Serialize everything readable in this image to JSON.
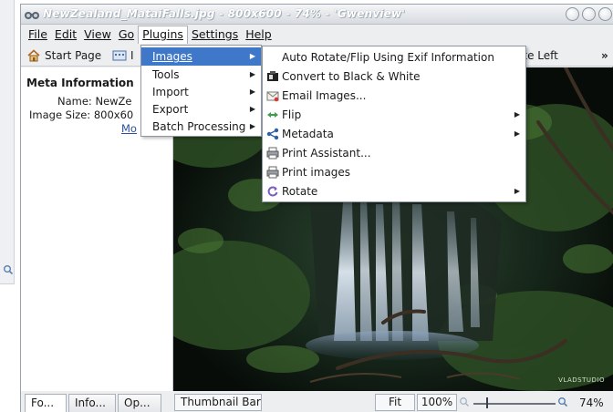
{
  "window": {
    "title": "NewZealand_MataiFalls.jpg - 800x600 - 74% - 'Gwenview'"
  },
  "menubar": {
    "items": [
      "File",
      "Edit",
      "View",
      "Go",
      "Plugins",
      "Settings",
      "Help"
    ]
  },
  "toolbar": {
    "start_page": "Start Page",
    "partial_label": "I",
    "rotate_left": "otate Left",
    "overflow": "»"
  },
  "sidebar": {
    "title": "Meta Information",
    "name_label": "Name:",
    "name_value": "NewZe",
    "size_label": "Image Size:",
    "size_value": "800x60",
    "more_link": "Mo"
  },
  "plugins_menu": {
    "items": [
      {
        "label": "Images",
        "has_submenu": true
      },
      {
        "label": "Tools",
        "has_submenu": true
      },
      {
        "label": "Import",
        "has_submenu": true
      },
      {
        "label": "Export",
        "has_submenu": true
      },
      {
        "label": "Batch Processing",
        "has_submenu": true
      }
    ]
  },
  "images_submenu": {
    "items": [
      {
        "label": "Auto Rotate/Flip Using Exif Information",
        "icon": "none",
        "has_submenu": false
      },
      {
        "label": "Convert to Black & White",
        "icon": "bw-icon",
        "has_submenu": false
      },
      {
        "label": "Email Images...",
        "icon": "email-icon",
        "has_submenu": false
      },
      {
        "label": "Flip",
        "icon": "flip-icon",
        "has_submenu": true
      },
      {
        "label": "Metadata",
        "icon": "metadata-icon",
        "has_submenu": true
      },
      {
        "label": "Print Assistant...",
        "icon": "printer-icon",
        "has_submenu": false
      },
      {
        "label": "Print images",
        "icon": "printer-icon",
        "has_submenu": false
      },
      {
        "label": "Rotate",
        "icon": "rotate-icon",
        "has_submenu": true
      }
    ]
  },
  "bottombar": {
    "tabs": [
      "Fo...",
      "Info...",
      "Op..."
    ],
    "thumbnail_bar": "Thumbnail Bar",
    "fit": "Fit",
    "zoom_100": "100%",
    "zoom_level": "74%"
  },
  "image": {
    "watermark": "VLADSTUDIO"
  },
  "colors": {
    "highlight": "#3f78c9",
    "link": "#2a4fa0"
  }
}
